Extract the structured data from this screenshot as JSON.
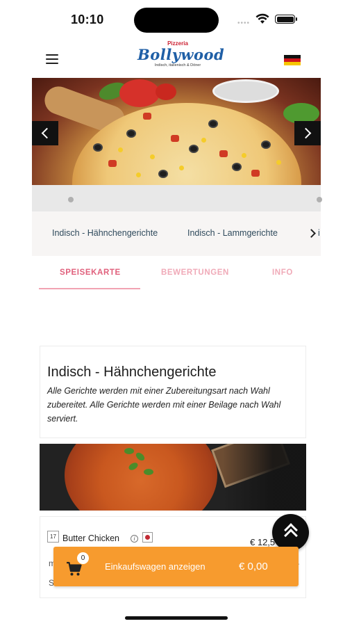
{
  "status_bar": {
    "time": "10:10",
    "wifi_icon": "wifi-icon",
    "battery_icon": "battery-icon"
  },
  "header": {
    "menu_icon": "hamburger-menu-icon",
    "logo": {
      "small": "Pizzeria",
      "main": "Bollywood",
      "tagline": "Indisch, italienisch & Döner"
    },
    "language_flag": "german-flag-icon"
  },
  "hero": {
    "prev_icon": "chevron-left-icon",
    "next_icon": "chevron-right-icon"
  },
  "categories": {
    "items": [
      "Indisch - Hähnchengerichte",
      "Indisch - Lammgerichte"
    ],
    "peek": "i"
  },
  "tabs": [
    {
      "label": "SPEISEKARTE",
      "active": true
    },
    {
      "label": "BEWERTUNGEN",
      "active": false
    },
    {
      "label": "INFO",
      "active": false
    }
  ],
  "section": {
    "title": "Indisch - Hähnchengerichte",
    "description": "Alle Gerichte werden mit einer Zubereitungsart nach Wahl zubereitet. Alle Gerichte werden mit einer Beilage nach Wahl serviert."
  },
  "product": {
    "number": "17",
    "name": "Butter Chicken",
    "price": "€ 12,5",
    "desc_left": "m",
    "desc_left2": "Sa",
    "desc_right": "–"
  },
  "cart": {
    "count": "0",
    "label": "Einkaufswagen anzeigen",
    "total": "€ 0,00"
  },
  "colors": {
    "accent_pink": "#e0607c",
    "cart_orange": "#f79b2e",
    "logo_blue": "#1f5fa6"
  }
}
